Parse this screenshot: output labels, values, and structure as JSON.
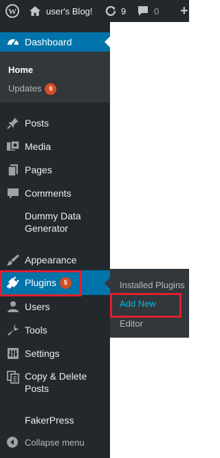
{
  "adminbar": {
    "site_name": "user's Blog!",
    "updates_count": "9",
    "comments_count": "0",
    "new_label": "+"
  },
  "sidebar": {
    "dashboard": "Dashboard",
    "dashboard_submenu": {
      "home": "Home",
      "updates": "Updates",
      "updates_badge": "9"
    },
    "items": [
      {
        "label": "Posts",
        "icon": "pin-icon"
      },
      {
        "label": "Media",
        "icon": "media-icon"
      },
      {
        "label": "Pages",
        "icon": "pages-icon"
      },
      {
        "label": "Comments",
        "icon": "comment-icon"
      },
      {
        "label": "Dummy Data Generator",
        "line1": "Dummy Data",
        "line2": "Generator"
      },
      {
        "label": "Appearance",
        "icon": "brush-icon"
      },
      {
        "label": "Plugins",
        "icon": "plugin-icon",
        "badge": "5"
      },
      {
        "label": "Users",
        "icon": "user-icon"
      },
      {
        "label": "Tools",
        "icon": "wrench-icon"
      },
      {
        "label": "Settings",
        "icon": "settings-icon"
      },
      {
        "label": "Copy & Delete Posts",
        "line1": "Copy & Delete",
        "line2": "Posts",
        "icon": "copy-icon"
      },
      {
        "label": "FakerPress"
      }
    ],
    "collapse": "Collapse menu"
  },
  "flyout": {
    "installed": "Installed Plugins",
    "add_new": "Add New",
    "editor": "Editor"
  },
  "colors": {
    "menu_bg": "#23282d",
    "submenu_bg": "#32373c",
    "active": "#0073aa",
    "highlight": "#e0202d",
    "badge": "#d54e21",
    "link_active": "#00b9eb"
  }
}
